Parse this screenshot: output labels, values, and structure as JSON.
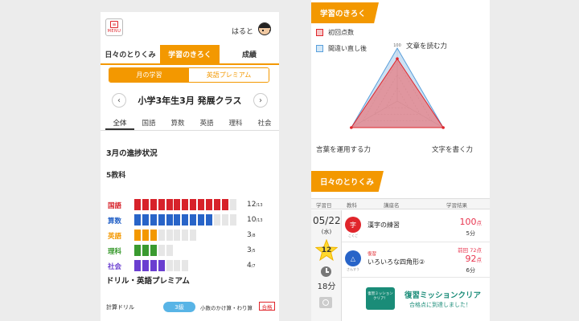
{
  "left": {
    "menu_label": "MENU",
    "username": "はると",
    "tabs": [
      "日々のとりくみ",
      "学習のきろく",
      "成績"
    ],
    "subtabs": [
      "月の学習",
      "英語プレミアム"
    ],
    "class_name": "小学3年生3月 発展クラス",
    "prev_glyph": "‹",
    "next_glyph": "›",
    "subjects": [
      "全体",
      "国語",
      "算数",
      "英語",
      "理科",
      "社会"
    ],
    "progress_title": "3月の進捗状況",
    "five_subjects_title": "5教科",
    "progress": [
      {
        "name": "国語",
        "done": "12",
        "total": "/13",
        "color": "#d7222a"
      },
      {
        "name": "算数",
        "done": "10",
        "total": "/13",
        "color": "#2864c8"
      },
      {
        "name": "英語",
        "done": "3",
        "total": "/8",
        "color": "#f39800"
      },
      {
        "name": "理科",
        "done": "3",
        "total": "/5",
        "color": "#3a9a2f"
      },
      {
        "name": "社会",
        "done": "4",
        "total": "/7",
        "color": "#6a3ed0"
      }
    ],
    "drill_title": "ドリル・英語プレミアム",
    "drill": {
      "label": "計算ドリル",
      "level": "3級",
      "topic": "小数のかけ算・わり算",
      "badge": "合格"
    }
  },
  "right": {
    "record_title": "学習のきろく",
    "legend": [
      {
        "label": "初回点数",
        "color": "#e0252b",
        "fill": "#f7c6c6"
      },
      {
        "label": "間違い直し後",
        "color": "#5aa0dc",
        "fill": "#d4e8f7"
      }
    ],
    "axes": [
      "文章を読む力",
      "文字を書く力",
      "言葉を運用する力"
    ],
    "scale_max": "100",
    "chart_data": {
      "type": "radar",
      "axes": [
        "文章を読む力",
        "文字を書く力",
        "言葉を運用する力"
      ],
      "series": [
        {
          "name": "初回点数",
          "values": [
            80,
            100,
            100
          ]
        },
        {
          "name": "間違い直し後",
          "values": [
            100,
            100,
            100
          ]
        }
      ],
      "rmax": 100
    },
    "daily_title": "日々のとりくみ",
    "columns": [
      "学習日",
      "教科",
      "講座名",
      "学習結果"
    ],
    "date": {
      "md": "05/22",
      "dow": "(水)"
    },
    "streak": "12",
    "minutes": "18分",
    "lessons": [
      {
        "subject": "こくご",
        "icon": "字",
        "color": "#e0252b",
        "name": "漢字の練習",
        "tag": "",
        "prev": "",
        "score": "100",
        "unit": "点",
        "time": "5分"
      },
      {
        "subject": "さんすう",
        "icon": "△",
        "color": "#2864c8",
        "name": "いろいろな四角形②",
        "tag": "復習",
        "prev": "前回 72点",
        "score": "92",
        "unit": "点",
        "time": "6分"
      }
    ],
    "banner": {
      "badge": "復習ミッション クリア！",
      "title": "復習ミッションクリア",
      "sub": "合格点に到達しました！"
    }
  }
}
